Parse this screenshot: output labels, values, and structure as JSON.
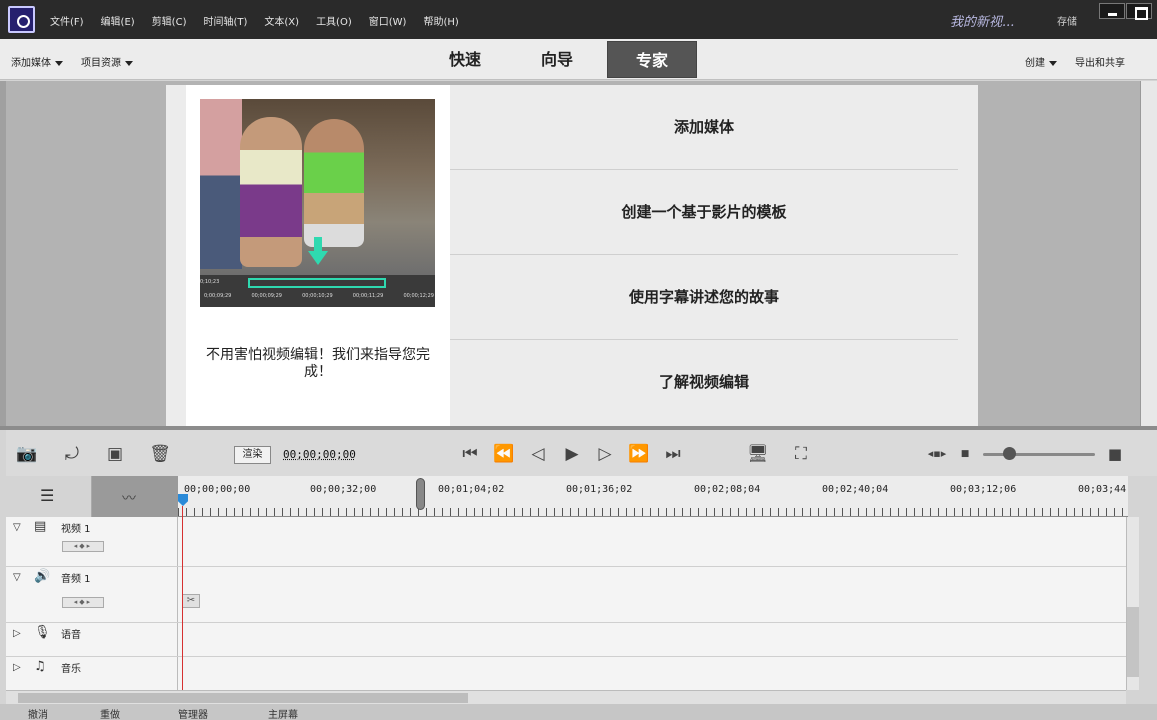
{
  "titlebar": {
    "menu": [
      "文件(F)",
      "编辑(E)",
      "剪辑(C)",
      "时间轴(T)",
      "文本(X)",
      "工具(O)",
      "窗口(W)",
      "帮助(H)"
    ],
    "project_name": "我的新视...",
    "save_label": "存储"
  },
  "modebar": {
    "add_media": "添加媒体",
    "project_assets": "项目资源",
    "tabs": [
      "快速",
      "向导",
      "专家"
    ],
    "active_tab": "专家",
    "create": "创建",
    "export_share": "导出和共享"
  },
  "guide": {
    "caption": "不用害怕视频编辑！我们来指导您完成！",
    "items": [
      "添加媒体",
      "创建一个基于影片的模板",
      "使用字幕讲述您的故事",
      "了解视频编辑"
    ],
    "thumb_timecodes": [
      "0;00;09;29",
      "00;00;09;29",
      "00;00;10;29",
      "00;00;11;29",
      "00;00;12;29"
    ],
    "thumb_start": "0;10;23"
  },
  "toolbar": {
    "render_label": "渲染",
    "timecode": "00;00;00;00"
  },
  "timeline": {
    "ruler_labels": [
      "00;00;00;00",
      "00;00;32;00",
      "00;01;04;02",
      "00;01;36;02",
      "00;02;08;04",
      "00;02;40;04",
      "00;03;12;06",
      "00;03;44;"
    ],
    "tracks": [
      "视频 1",
      "音频 1",
      "语音",
      "音乐"
    ]
  },
  "bottom": {
    "undo": "撤消",
    "redo": "重做",
    "organizer": "管理器",
    "home": "主屏幕"
  }
}
